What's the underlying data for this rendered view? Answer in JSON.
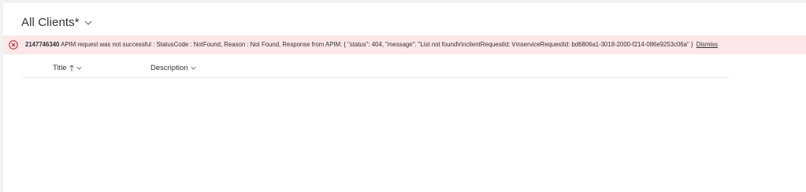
{
  "view": {
    "title": "All Clients*",
    "chevron_icon": "chevron-down-icon"
  },
  "error": {
    "icon": "error-circle-icon",
    "code": "2147746340",
    "message": "APIM request was not successful : StatusCode : NotFound, Reason : Not Found, Response from APIM: { \"status\": 404, \"message\": \"List not found\\r\\nclientRequestId: \\r\\nserviceRequestId: bd6806a1-3018-2000-f214-086e9253c06a\" }",
    "dismiss_label": "Dismiss",
    "background_color": "#fde7e9",
    "icon_color": "#a4262c"
  },
  "list": {
    "columns": [
      {
        "label": "Title",
        "sort_icon": "arrow-up-icon",
        "menu_icon": "chevron-down-icon"
      },
      {
        "label": "Description",
        "menu_icon": "chevron-down-icon"
      }
    ],
    "rows": []
  }
}
